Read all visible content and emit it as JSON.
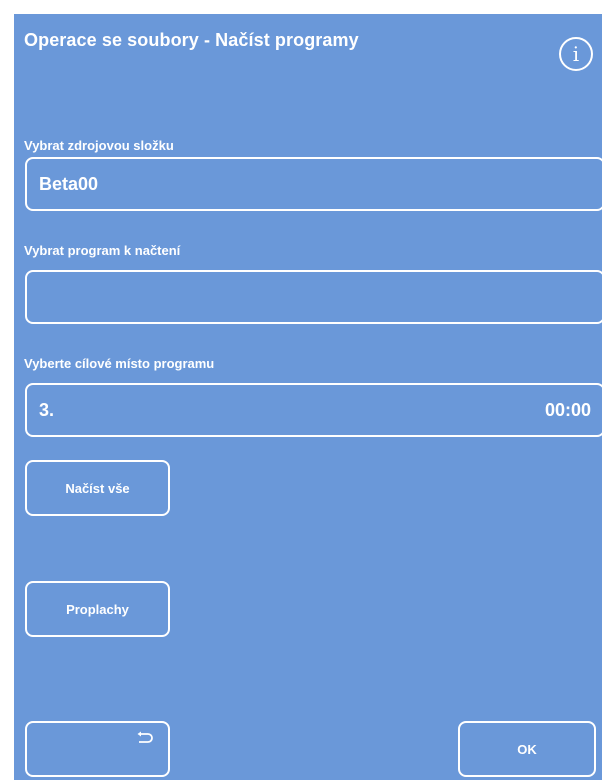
{
  "header": {
    "title": "Operace se soubory - Načíst programy",
    "info_icon": "info-icon",
    "info_glyph": "i"
  },
  "source_folder": {
    "label": "Vybrat zdrojovou složku",
    "value": "Beta00"
  },
  "program": {
    "label": "Vybrat program k načtení",
    "value": ""
  },
  "destination": {
    "label": "Vyberte cílové místo programu",
    "slot": "3.",
    "time": "00:00"
  },
  "buttons": {
    "load_all": "Načíst vše",
    "rinses": "Proplachy",
    "back_icon": "back-arrow-icon",
    "ok": "OK"
  },
  "colors": {
    "background": "#6a98d9",
    "foreground": "#ffffff"
  }
}
